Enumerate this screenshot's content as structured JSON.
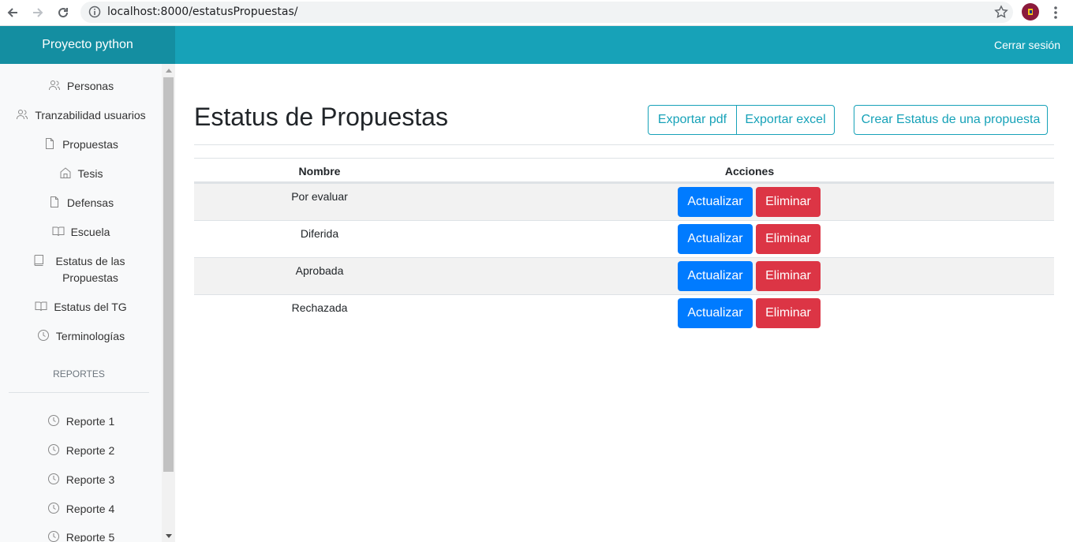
{
  "browser": {
    "url": "localhost:8000/estatusPropuestas/"
  },
  "header": {
    "brand": "Proyecto python",
    "logout_label": "Cerrar sesión",
    "accent_color": "#17a2b8"
  },
  "sidebar": {
    "items": [
      {
        "label": "Personas",
        "icon": "users-icon"
      },
      {
        "label": "Tranzabilidad usuarios",
        "icon": "users-icon"
      },
      {
        "label": "Propuestas",
        "icon": "file-icon"
      },
      {
        "label": "Tesis",
        "icon": "home-icon"
      },
      {
        "label": "Defensas",
        "icon": "file-icon"
      },
      {
        "label": "Escuela",
        "icon": "book-open-icon"
      },
      {
        "label": "Estatus de las Propuestas",
        "icon": "book-icon"
      },
      {
        "label": "Estatus del TG",
        "icon": "book-open-icon"
      },
      {
        "label": "Terminologías",
        "icon": "clock-icon"
      }
    ],
    "reports_heading": "REPORTES",
    "reports": [
      {
        "label": "Reporte 1",
        "icon": "clock-icon"
      },
      {
        "label": "Reporte 2",
        "icon": "clock-icon"
      },
      {
        "label": "Reporte 3",
        "icon": "clock-icon"
      },
      {
        "label": "Reporte 4",
        "icon": "clock-icon"
      },
      {
        "label": "Reporte 5",
        "icon": "clock-icon"
      }
    ]
  },
  "main": {
    "title": "Estatus de Propuestas",
    "export_pdf_label": "Exportar pdf",
    "export_excel_label": "Exportar excel",
    "create_label": "Crear Estatus de una propuesta",
    "table": {
      "headers": {
        "name": "Nombre",
        "actions": "Acciones"
      },
      "rows": [
        {
          "name": "Por evaluar",
          "update_label": "Actualizar",
          "delete_label": "Eliminar"
        },
        {
          "name": "Diferida",
          "update_label": "Actualizar",
          "delete_label": "Eliminar"
        },
        {
          "name": "Aprobada",
          "update_label": "Actualizar",
          "delete_label": "Eliminar"
        },
        {
          "name": "Rechazada",
          "update_label": "Actualizar",
          "delete_label": "Eliminar"
        }
      ]
    },
    "colors": {
      "primary": "#007bff",
      "danger": "#dc3545"
    }
  }
}
